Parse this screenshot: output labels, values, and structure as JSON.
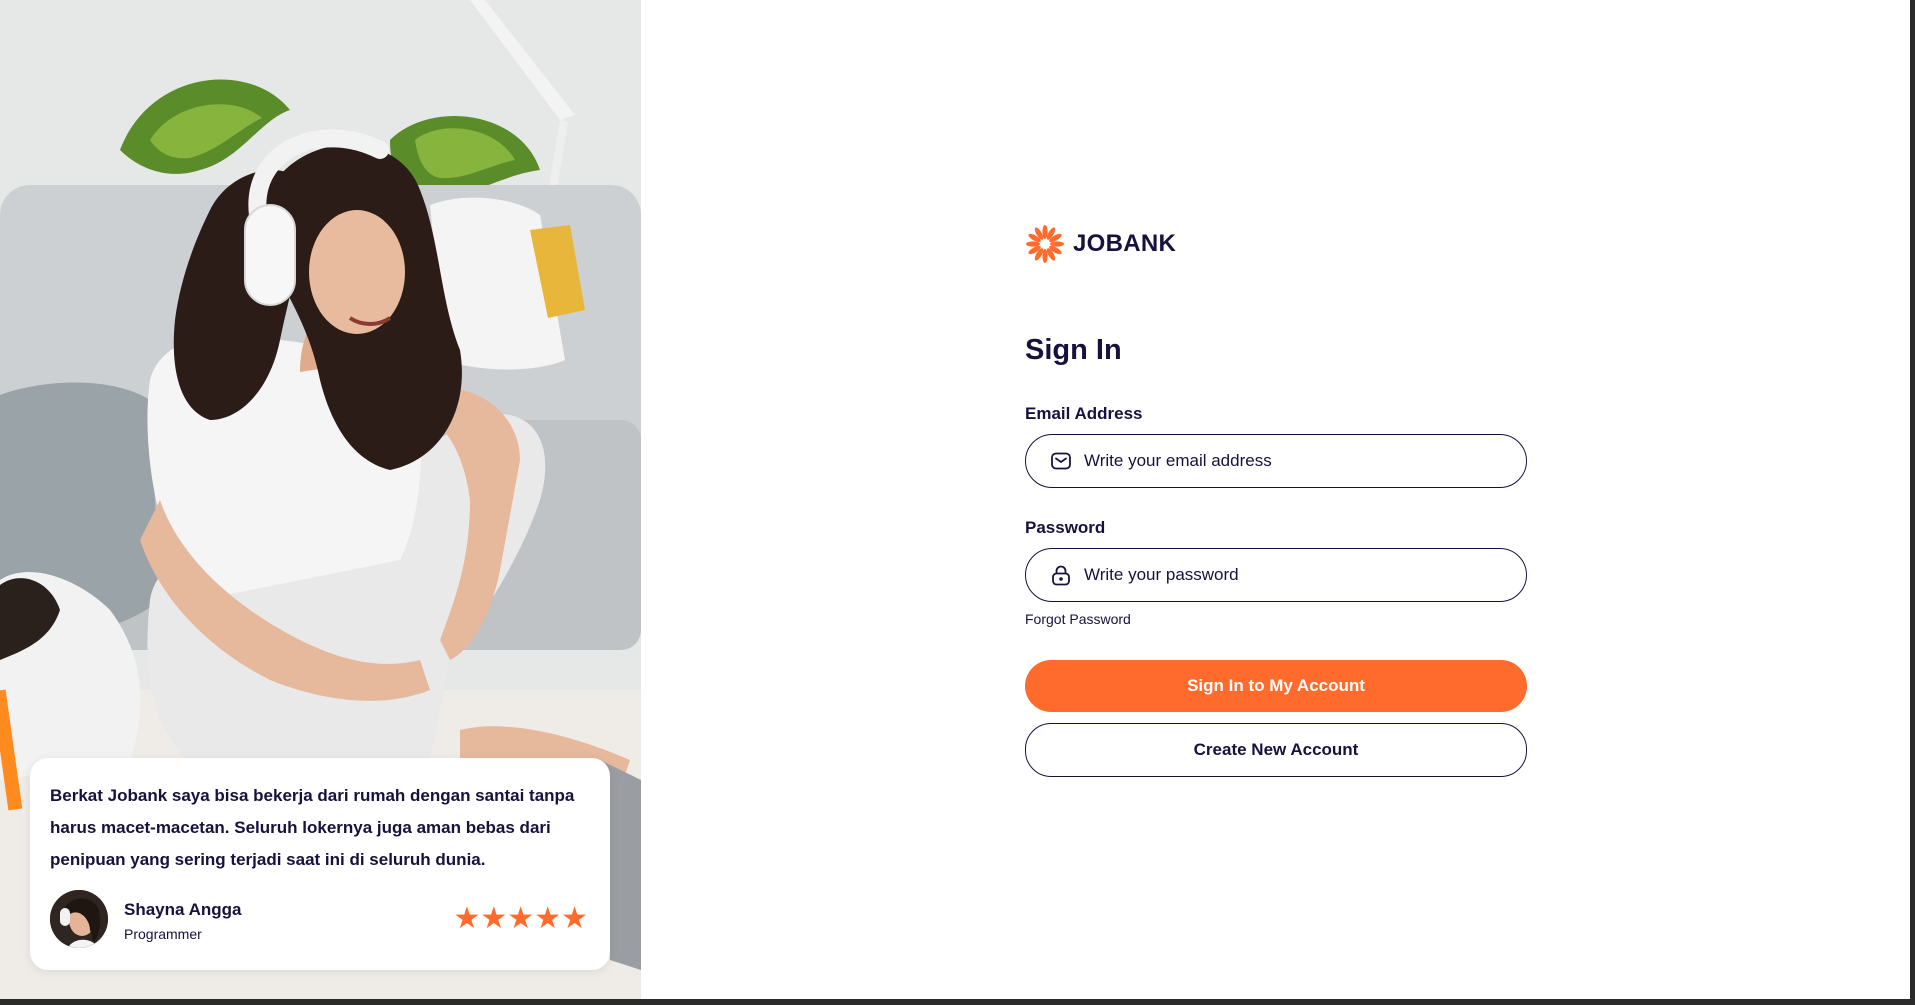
{
  "brand": {
    "name": "JOBANK",
    "accent_color": "#ff6b2c",
    "text_color": "#17113d"
  },
  "signin": {
    "title": "Sign In",
    "email": {
      "label": "Email Address",
      "placeholder": "Write your email address",
      "value": "",
      "icon": "mail-icon"
    },
    "password": {
      "label": "Password",
      "placeholder": "Write your password",
      "value": "",
      "icon": "lock-icon"
    },
    "forgot_label": "Forgot Password",
    "submit_label": "Sign In to My Account",
    "create_label": "Create New Account"
  },
  "testimonial": {
    "quote": "Berkat Jobank saya bisa bekerja dari rumah dengan santai tanpa harus macet-macetan. Seluruh lokernya juga aman bebas dari penipuan yang sering terjadi saat ini di seluruh dunia.",
    "author_name": "Shayna Angga",
    "author_role": "Programmer",
    "rating": 5,
    "rating_max": 5,
    "stars": "★★★★★"
  }
}
